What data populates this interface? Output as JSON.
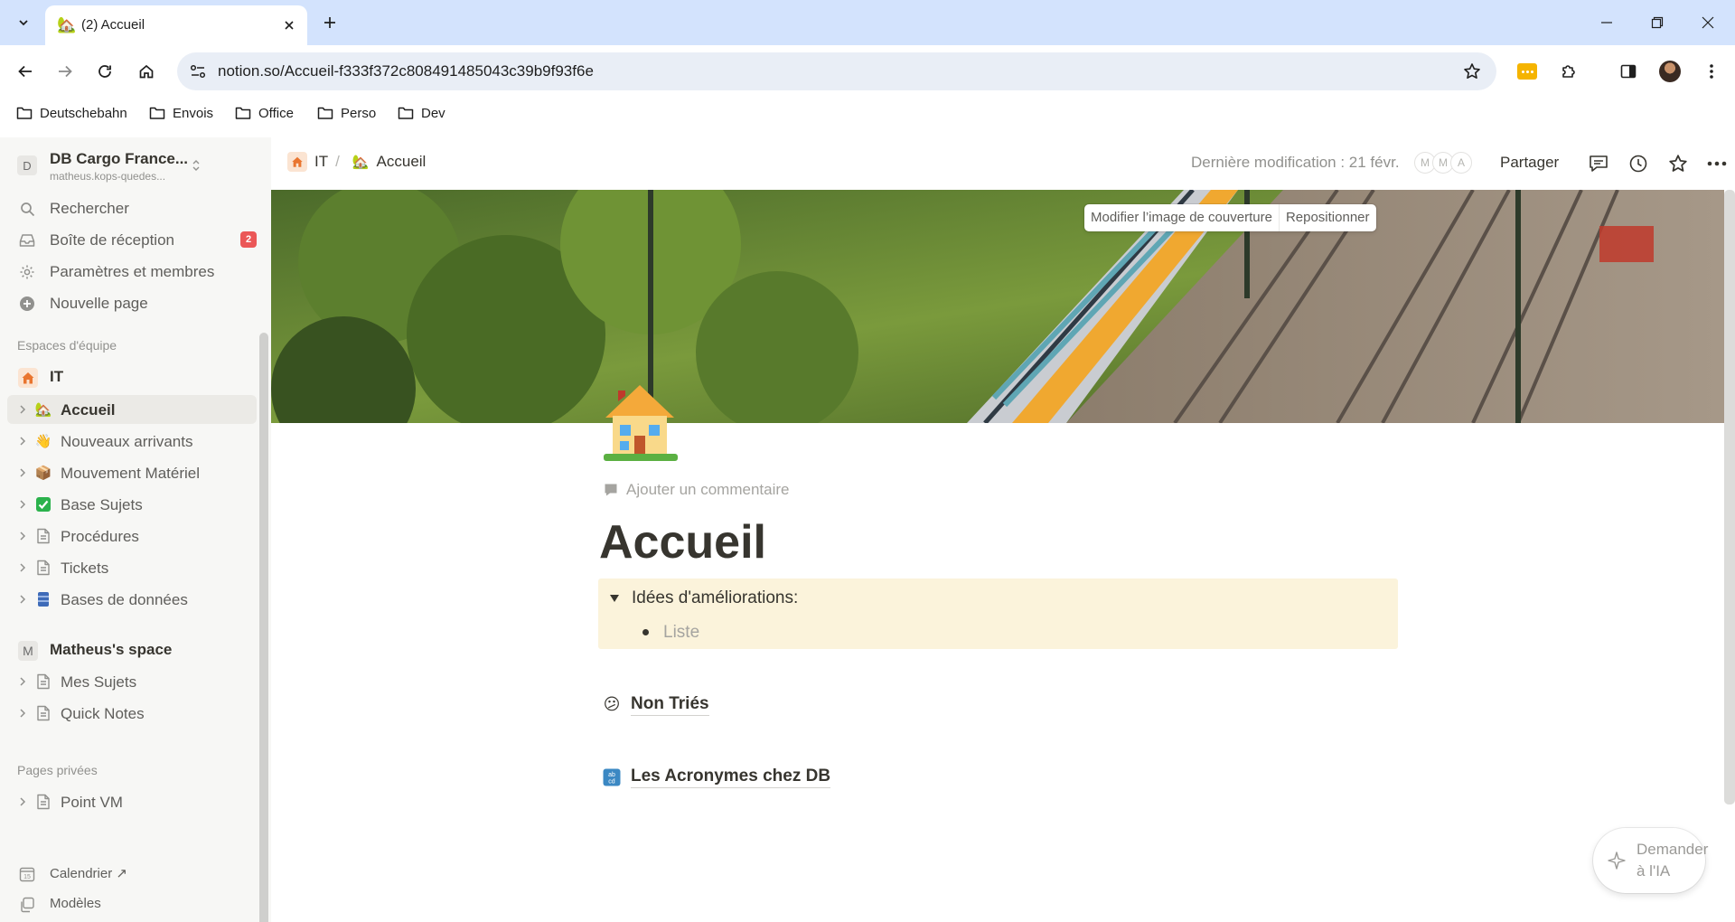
{
  "browser": {
    "tab": {
      "title": "(2) Accueil",
      "favicon": "house-emoji"
    },
    "url": "notion.so/Accueil-f333f372c808491485043c39b9f93f6e",
    "bookmarks": [
      {
        "label": "Deutschebahn"
      },
      {
        "label": "Envois"
      },
      {
        "label": "Office"
      },
      {
        "label": "Perso"
      },
      {
        "label": "Dev"
      }
    ]
  },
  "sidebar": {
    "workspace": {
      "initial": "D",
      "name": "DB Cargo France...",
      "email": "matheus.kops-quedes..."
    },
    "top_items": [
      {
        "label": "Rechercher",
        "icon": "search-icon"
      },
      {
        "label": "Boîte de réception",
        "icon": "inbox-icon",
        "badge": "2"
      },
      {
        "label": "Paramètres et membres",
        "icon": "gear-icon"
      },
      {
        "label": "Nouvelle page",
        "icon": "plus-circle-icon"
      }
    ],
    "teamspaces_label": "Espaces d'équipe",
    "team": {
      "label": "IT",
      "icon": "house-icon"
    },
    "team_pages": [
      {
        "label": "Accueil",
        "icon": "🏡",
        "active": true
      },
      {
        "label": "Nouveaux arrivants",
        "icon": "👋"
      },
      {
        "label": "Mouvement Matériel",
        "icon": "📦"
      },
      {
        "label": "Base Sujets",
        "icon": "✅"
      },
      {
        "label": "Procédures",
        "icon": "page-icon"
      },
      {
        "label": "Tickets",
        "icon": "page-icon"
      },
      {
        "label": "Bases de données",
        "icon": "🗄"
      }
    ],
    "personal_space": {
      "initial": "M",
      "label": "Matheus's space"
    },
    "personal_pages": [
      {
        "label": "Mes Sujets",
        "icon": "page-icon"
      },
      {
        "label": "Quick Notes",
        "icon": "page-icon"
      }
    ],
    "private_label": "Pages privées",
    "private_pages": [
      {
        "label": "Point VM",
        "icon": "page-icon"
      }
    ],
    "bottom_items": [
      {
        "label": "Calendrier ↗",
        "icon": "calendar-icon",
        "day": "15"
      },
      {
        "label": "Modèles",
        "icon": "templates-icon"
      }
    ]
  },
  "topbar": {
    "breadcrumb": [
      {
        "label": "IT",
        "icon": "house-icon"
      },
      {
        "label": "Accueil",
        "icon": "🏡"
      }
    ],
    "separator": "/",
    "last_edited": "Dernière modification : 21 févr.",
    "faces": [
      "M",
      "M",
      "A"
    ],
    "share_label": "Partager"
  },
  "cover": {
    "change_label": "Modifier l’image de couverture",
    "reposition_label": "Repositionner"
  },
  "page": {
    "add_comment": "Ajouter un commentaire",
    "title": "Accueil",
    "toggle": {
      "label": "Idées d'améliorations:",
      "bullet_placeholder": "Liste",
      "bg": "#fbf3db"
    },
    "links": [
      {
        "label": "Non Triés",
        "icon": "😕"
      },
      {
        "label": "Les Acronymes chez DB",
        "icon": "🔡"
      }
    ]
  },
  "ask_ai": {
    "label": "Demander à l'IA"
  }
}
